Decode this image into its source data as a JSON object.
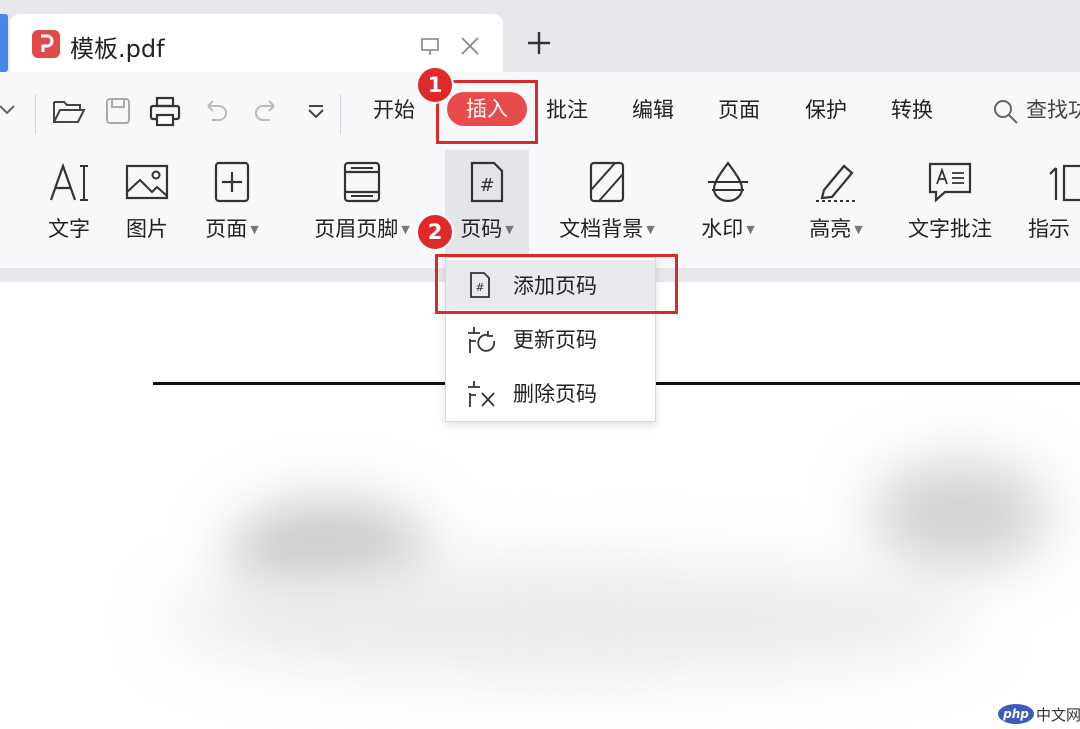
{
  "tab": {
    "title": "模板.pdf"
  },
  "quick_access": [
    "folder-open-icon",
    "save-icon",
    "print-icon",
    "undo-icon",
    "redo-icon",
    "more-dropdown-icon"
  ],
  "menu": {
    "start": "开始",
    "insert": "插入",
    "annotate": "批注",
    "edit": "编辑",
    "page": "页面",
    "protect": "保护",
    "convert": "转换",
    "search": "查找功"
  },
  "ribbon": {
    "text": "文字",
    "image": "图片",
    "page": "页面",
    "header_footer": "页眉页脚",
    "page_number": "页码",
    "doc_background": "文档背景",
    "watermark": "水印",
    "highlight": "高亮",
    "text_annotation": "文字批注",
    "pointer": "指示"
  },
  "dropdown": {
    "add": "添加页码",
    "update": "更新页码",
    "delete": "删除页码"
  },
  "badges": {
    "step1": "1",
    "step2": "2"
  },
  "watermark": {
    "logo": "php",
    "text": "中文网"
  },
  "colors": {
    "accent": "#e84b4b",
    "highlight_box": "#d72a2a",
    "tab_bar": "#e6e8ec"
  }
}
